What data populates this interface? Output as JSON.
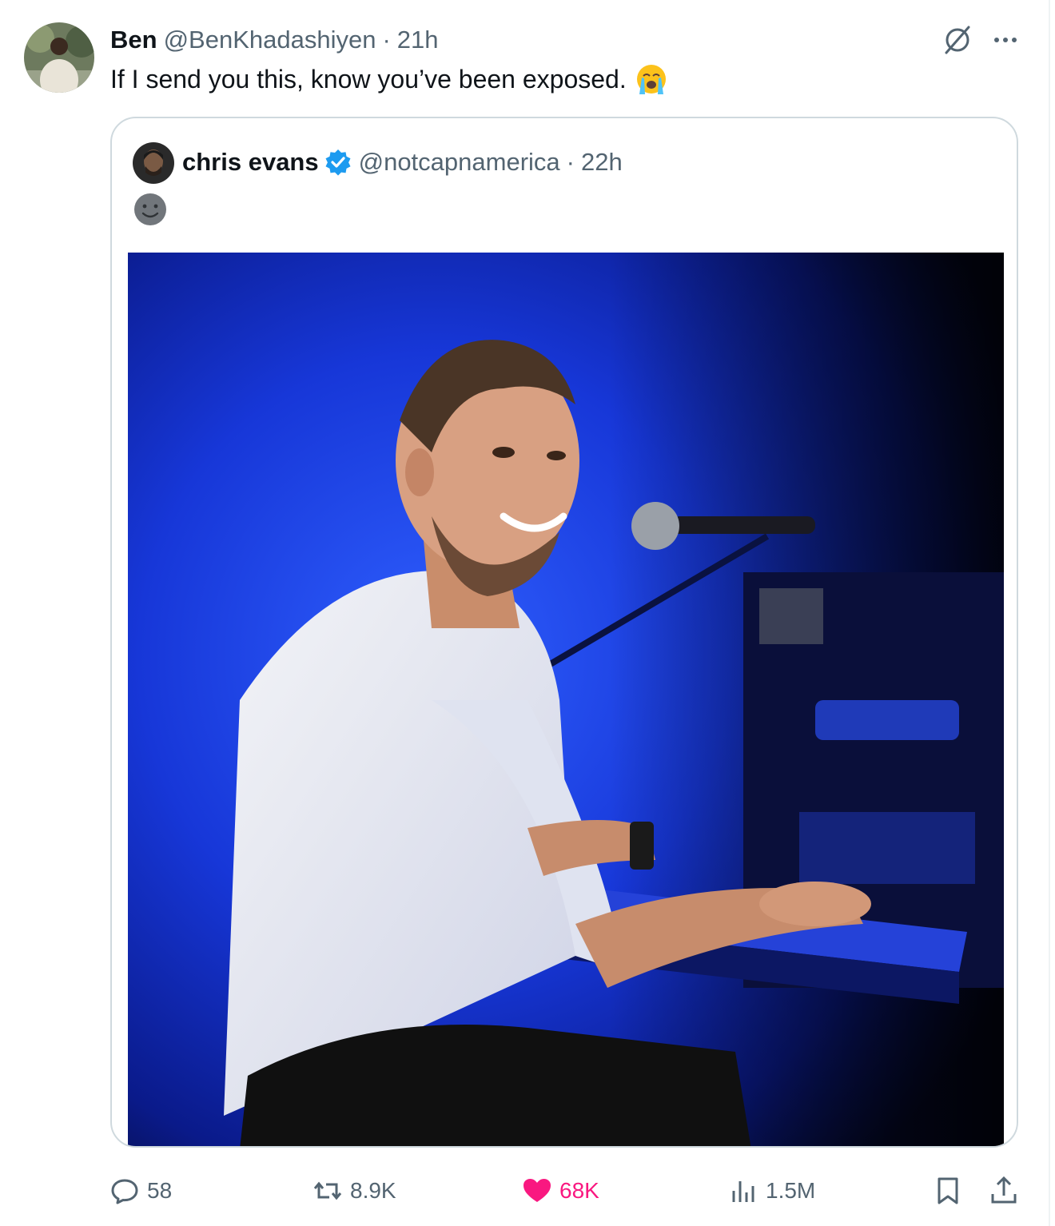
{
  "tweet": {
    "author": {
      "name": "Ben",
      "handle": "@BenKhadashiyen",
      "time": "21h"
    },
    "text": "If I send you this, know you’ve been exposed.",
    "emoji": "loudly-crying-face"
  },
  "quoted": {
    "author": {
      "name": "chris evans",
      "handle": "@notcapnamerica",
      "time": "22h",
      "verified": true
    },
    "emoji": "slightly-smiling-face",
    "media": "photo-man-smiling-at-piano-with-microphone-blue-stage-light"
  },
  "actions": {
    "replies": "58",
    "reposts": "8.9K",
    "likes": "68K",
    "views": "1.5M"
  },
  "colors": {
    "text": "#0f1419",
    "secondary": "#536471",
    "like": "#f91880",
    "verified": "#1d9bf0",
    "border": "#cfd9de"
  },
  "dot_separator": "·"
}
